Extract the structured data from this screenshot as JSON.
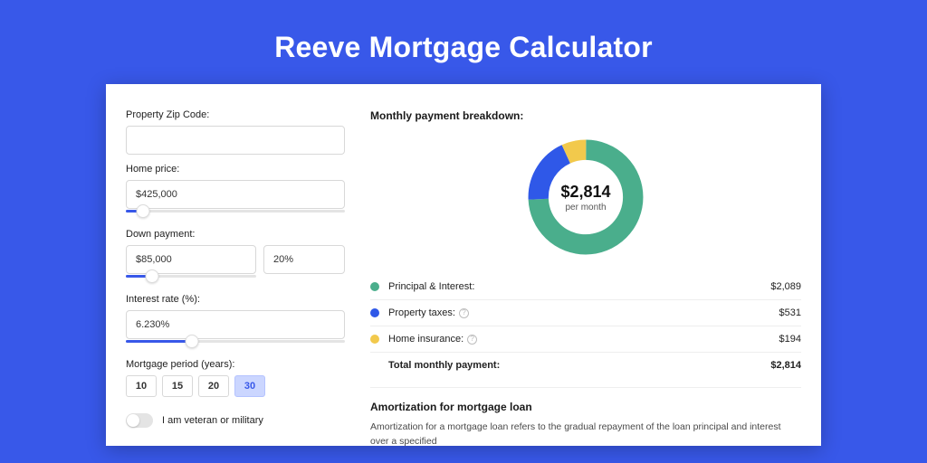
{
  "title": "Reeve Mortgage Calculator",
  "form": {
    "zip": {
      "label": "Property Zip Code:",
      "value": ""
    },
    "home_price": {
      "label": "Home price:",
      "value": "$425,000",
      "slider_pct": 8
    },
    "down_payment": {
      "label": "Down payment:",
      "amount": "$85,000",
      "pct": "20%",
      "slider_pct": 20
    },
    "interest": {
      "label": "Interest rate (%):",
      "value": "6.230%",
      "slider_pct": 30
    },
    "period": {
      "label": "Mortgage period (years):",
      "options": [
        "10",
        "15",
        "20",
        "30"
      ],
      "selected": "30"
    },
    "veteran": {
      "label": "I am veteran or military",
      "checked": false
    }
  },
  "breakdown": {
    "title": "Monthly payment breakdown:",
    "center_amount": "$2,814",
    "center_sub": "per month",
    "items": [
      {
        "label": "Principal & Interest:",
        "value": "$2,089",
        "color": "#4aae8c",
        "info": false
      },
      {
        "label": "Property taxes:",
        "value": "$531",
        "color": "#2f58e8",
        "info": true
      },
      {
        "label": "Home insurance:",
        "value": "$194",
        "color": "#f2c94c",
        "info": true
      }
    ],
    "total": {
      "label": "Total monthly payment:",
      "value": "$2,814"
    }
  },
  "amort": {
    "title": "Amortization for mortgage loan",
    "text": "Amortization for a mortgage loan refers to the gradual repayment of the loan principal and interest over a specified"
  },
  "chart_data": {
    "type": "pie",
    "donut": true,
    "series": [
      {
        "name": "Principal & Interest",
        "value": 2089,
        "color": "#4aae8c"
      },
      {
        "name": "Property taxes",
        "value": 531,
        "color": "#2f58e8"
      },
      {
        "name": "Home insurance",
        "value": 194,
        "color": "#f2c94c"
      }
    ],
    "total": 2814,
    "center_label": "$2,814",
    "center_sub": "per month"
  }
}
